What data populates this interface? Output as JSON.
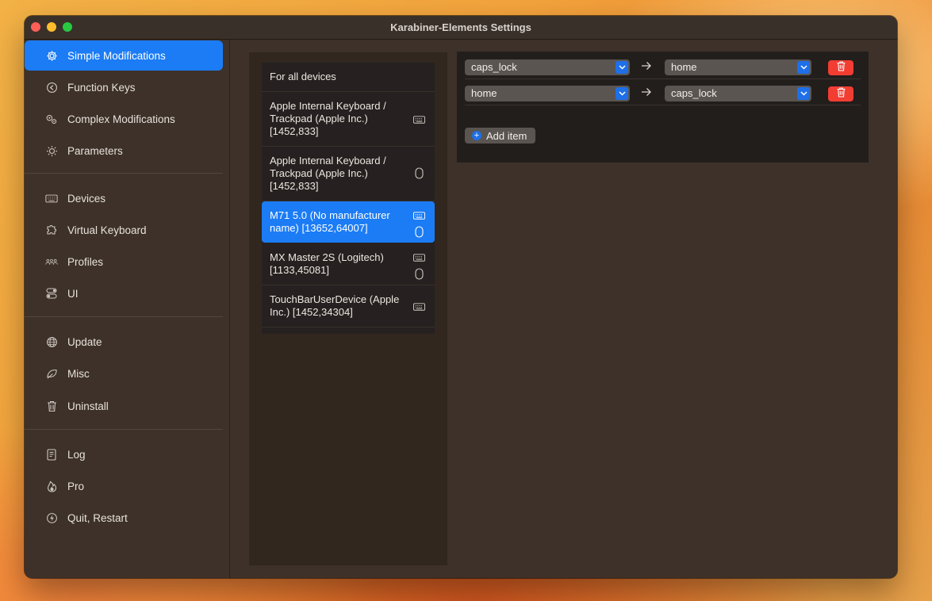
{
  "window": {
    "title": "Karabiner-Elements Settings"
  },
  "sidebar": {
    "items": [
      {
        "label": "Simple Modifications",
        "icon": "gear-icon"
      },
      {
        "label": "Function Keys",
        "icon": "function-key-icon"
      },
      {
        "label": "Complex Modifications",
        "icon": "gears-icon"
      },
      {
        "label": "Parameters",
        "icon": "sun-icon"
      },
      {
        "label": "Devices",
        "icon": "keyboard-icon"
      },
      {
        "label": "Virtual Keyboard",
        "icon": "puzzle-icon"
      },
      {
        "label": "Profiles",
        "icon": "people-icon"
      },
      {
        "label": "UI",
        "icon": "toggle-icon"
      },
      {
        "label": "Update",
        "icon": "globe-icon"
      },
      {
        "label": "Misc",
        "icon": "leaf-icon"
      },
      {
        "label": "Uninstall",
        "icon": "trash-icon"
      },
      {
        "label": "Log",
        "icon": "document-icon"
      },
      {
        "label": "Pro",
        "icon": "flame-icon"
      },
      {
        "label": "Quit, Restart",
        "icon": "bolt-icon"
      }
    ],
    "selected": "Simple Modifications"
  },
  "devices": {
    "items": [
      {
        "label": "For all devices",
        "icons": []
      },
      {
        "label": "Apple Internal Keyboard / Trackpad (Apple Inc.) [1452,833]",
        "icons": [
          "keyboard-icon"
        ]
      },
      {
        "label": "Apple Internal Keyboard / Trackpad (Apple Inc.) [1452,833]",
        "icons": [
          "mouse-icon"
        ]
      },
      {
        "label": "M71 5.0  (No manufacturer name) [13652,64007]",
        "icons": [
          "keyboard-icon",
          "mouse-icon"
        ]
      },
      {
        "label": "MX Master 2S (Logitech) [1133,45081]",
        "icons": [
          "keyboard-icon",
          "mouse-icon"
        ]
      },
      {
        "label": "TouchBarUserDevice (Apple Inc.) [1452,34304]",
        "icons": [
          "keyboard-icon"
        ]
      }
    ],
    "selected": "M71 5.0  (No manufacturer name) [13652,64007]"
  },
  "mappings": {
    "rows": [
      {
        "from": "caps_lock",
        "to": "home"
      },
      {
        "from": "home",
        "to": "caps_lock"
      }
    ],
    "add_label": "Add item"
  },
  "colors": {
    "accent": "#1b7cf5",
    "delete": "#f23d33"
  }
}
